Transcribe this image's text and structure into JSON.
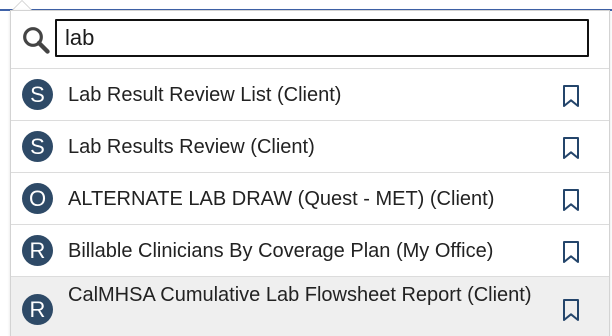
{
  "search": {
    "value": "lab",
    "icon": "search-icon"
  },
  "results": [
    {
      "badge": "S",
      "label": "Lab Result Review List (Client)",
      "icon": "bookmark-icon"
    },
    {
      "badge": "S",
      "label": "Lab Results Review (Client)",
      "icon": "bookmark-icon"
    },
    {
      "badge": "O",
      "label": "ALTERNATE LAB DRAW (Quest - MET) (Client)",
      "icon": "bookmark-icon"
    },
    {
      "badge": "R",
      "label": "Billable Clinicians By Coverage Plan (My Office)",
      "icon": "bookmark-icon"
    },
    {
      "badge": "R",
      "label": "CalMHSA Cumulative Lab Flowsheet Report (Client)",
      "icon": "bookmark-icon"
    }
  ],
  "colors": {
    "accent": "#3f62a8",
    "badge": "#2e4a67",
    "highlight": "#efefef"
  }
}
